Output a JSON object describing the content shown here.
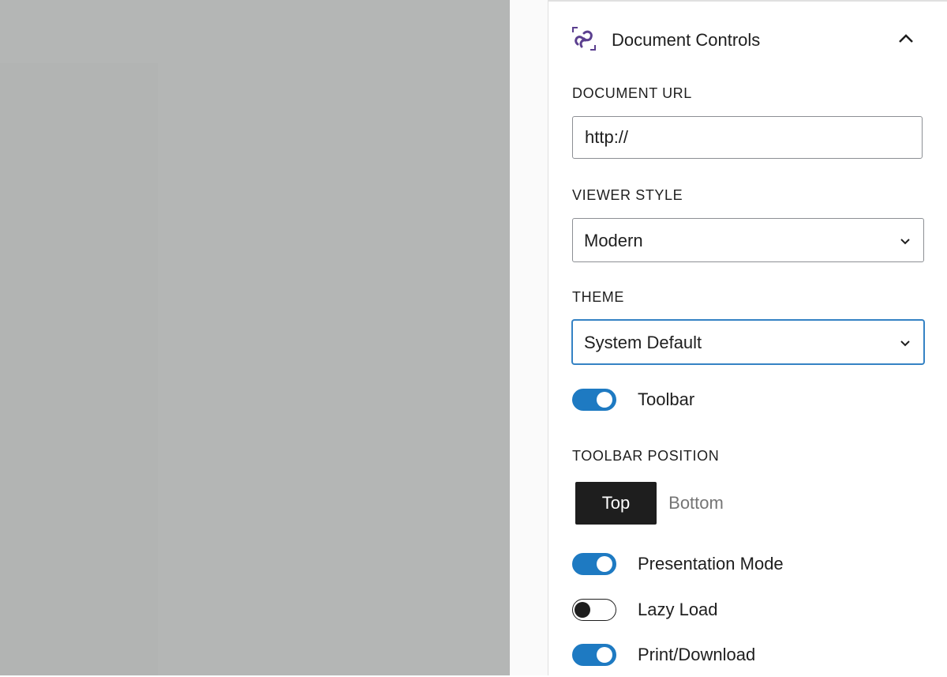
{
  "panel": {
    "title": "Document Controls",
    "logo_icon": "document-embed-logo-icon",
    "collapse_icon": "chevron-up-icon"
  },
  "document_url": {
    "label": "DOCUMENT URL",
    "value": "http://"
  },
  "viewer_style": {
    "label": "VIEWER STYLE",
    "selected": "Modern"
  },
  "theme": {
    "label": "THEME",
    "selected": "System Default"
  },
  "toolbar_toggle": {
    "label": "Toolbar",
    "enabled": true
  },
  "toolbar_position": {
    "label": "TOOLBAR POSITION",
    "options": [
      "Top",
      "Bottom"
    ],
    "selected": "Top"
  },
  "presentation_mode": {
    "label": "Presentation Mode",
    "enabled": true
  },
  "lazy_load": {
    "label": "Lazy Load",
    "enabled": false
  },
  "print_download": {
    "label": "Print/Download",
    "enabled": true
  },
  "colors": {
    "accent": "#1e7ac2",
    "focus": "#3582c4",
    "logo": "#5b3f8f",
    "canvas": "#b4b6b5"
  }
}
